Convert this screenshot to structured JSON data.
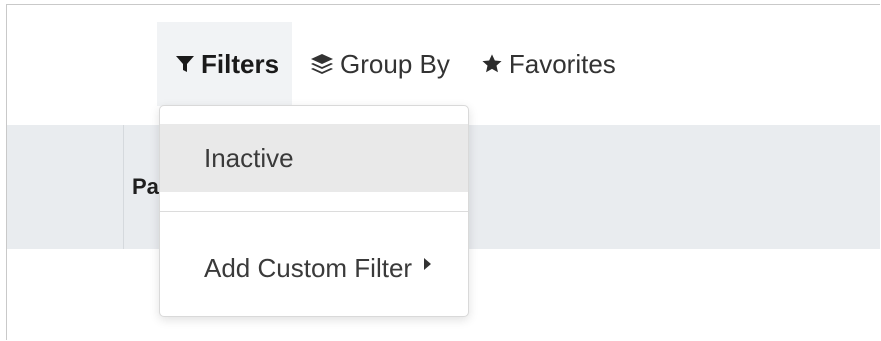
{
  "toolbar": {
    "filters": {
      "label": "Filters",
      "icon": "filter-icon"
    },
    "group_by": {
      "label": "Group By",
      "icon": "layers-icon"
    },
    "favorites": {
      "label": "Favorites",
      "icon": "star-icon"
    }
  },
  "table": {
    "column_header": "Pa"
  },
  "filters_menu": {
    "items": [
      {
        "label": "Inactive"
      },
      {
        "label": "Add Custom Filter",
        "icon": "caret-right-icon"
      }
    ]
  },
  "colors": {
    "header_band": "#e9ecef",
    "active_button_bg": "#f1f3f5",
    "highlighted_item_bg": "#e9e9e9"
  }
}
